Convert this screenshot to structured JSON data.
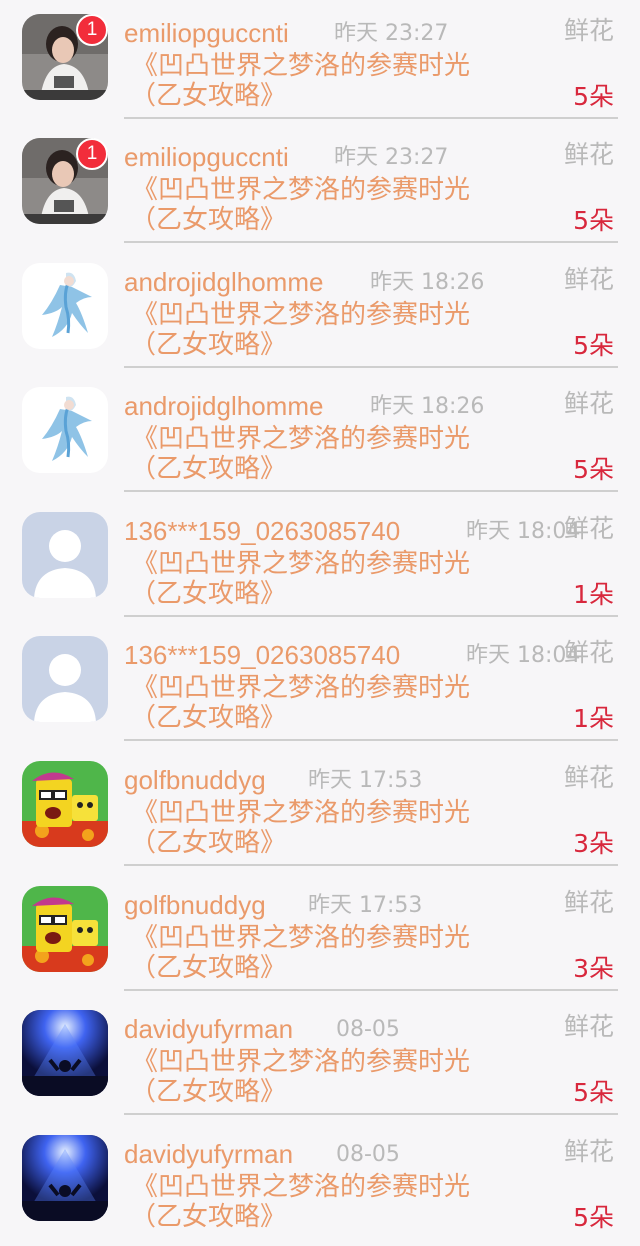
{
  "rows": [
    {
      "username": "emiliopguccnti",
      "time": "昨天 23:27",
      "gift_label": "鲜花",
      "title_line1": "《凹凸世界之梦洛的参赛时光",
      "title_line2": "（乙女攻略》",
      "count": "5朵",
      "badge": "1",
      "avatar": "avatar-photo-icon"
    },
    {
      "username": "emiliopguccnti",
      "time": "昨天 23:27",
      "gift_label": "鲜花",
      "title_line1": "《凹凸世界之梦洛的参赛时光",
      "title_line2": "（乙女攻略》",
      "count": "5朵",
      "badge": "1",
      "avatar": "avatar-photo-icon"
    },
    {
      "username": "androjidglhomme",
      "time": "昨天 18:26",
      "gift_label": "鲜花",
      "title_line1": "《凹凸世界之梦洛的参赛时光",
      "title_line2": "（乙女攻略》",
      "count": "5朵",
      "badge": "",
      "avatar": "avatar-anime-icon"
    },
    {
      "username": "androjidglhomme",
      "time": "昨天 18:26",
      "gift_label": "鲜花",
      "title_line1": "《凹凸世界之梦洛的参赛时光",
      "title_line2": "（乙女攻略》",
      "count": "5朵",
      "badge": "",
      "avatar": "avatar-anime-icon"
    },
    {
      "username": "136***159_0263085740",
      "time": "昨天 18:04",
      "gift_label": "鲜花",
      "title_line1": "《凹凸世界之梦洛的参赛时光",
      "title_line2": "（乙女攻略》",
      "count": "1朵",
      "badge": "",
      "avatar": "default-avatar-icon"
    },
    {
      "username": "136***159_0263085740",
      "time": "昨天 18:04",
      "gift_label": "鲜花",
      "title_line1": "《凹凸世界之梦洛的参赛时光",
      "title_line2": "（乙女攻略》",
      "count": "1朵",
      "badge": "",
      "avatar": "default-avatar-icon"
    },
    {
      "username": "golfbnuddyg",
      "time": "昨天 17:53",
      "gift_label": "鲜花",
      "title_line1": "《凹凸世界之梦洛的参赛时光",
      "title_line2": "（乙女攻略》",
      "count": "3朵",
      "badge": "",
      "avatar": "avatar-cartoon-icon"
    },
    {
      "username": "golfbnuddyg",
      "time": "昨天 17:53",
      "gift_label": "鲜花",
      "title_line1": "《凹凸世界之梦洛的参赛时光",
      "title_line2": "（乙女攻略》",
      "count": "3朵",
      "badge": "",
      "avatar": "avatar-cartoon-icon"
    },
    {
      "username": "davidyufyrman",
      "time": "08-05",
      "gift_label": "鲜花",
      "title_line1": "《凹凸世界之梦洛的参赛时光",
      "title_line2": "（乙女攻略》",
      "count": "5朵",
      "badge": "",
      "avatar": "avatar-concert-icon"
    },
    {
      "username": "davidyufyrman",
      "time": "08-05",
      "gift_label": "鲜花",
      "title_line1": "《凹凸世界之梦洛的参赛时光",
      "title_line2": "（乙女攻略》",
      "count": "5朵",
      "badge": "",
      "avatar": "avatar-concert-icon"
    }
  ],
  "colors": {
    "username": "#ea9a6a",
    "title": "#ea9a6a",
    "time": "#b9b9b9",
    "count": "#d8283d",
    "badge": "#f22d3b"
  }
}
